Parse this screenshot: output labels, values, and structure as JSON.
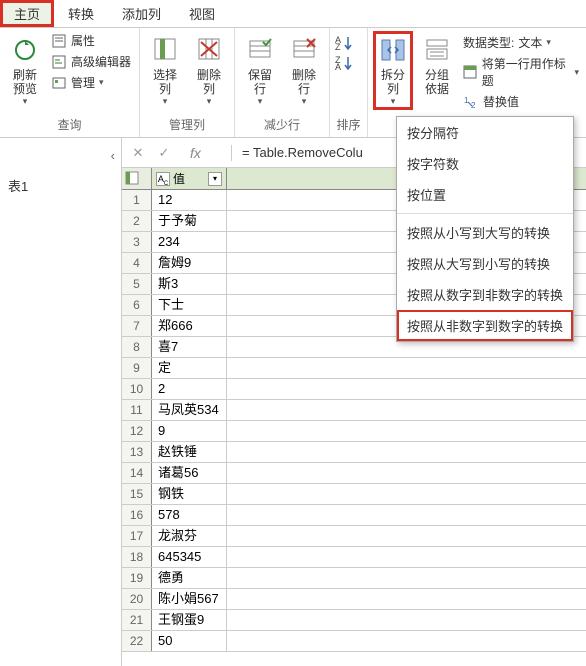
{
  "tabs": [
    "主页",
    "转换",
    "添加列",
    "视图"
  ],
  "ribbon": {
    "query": {
      "refresh": "刷新\n预览",
      "props": "属性",
      "advanced": "高级编辑器",
      "manage": "管理",
      "label": "查询"
    },
    "manage_cols": {
      "select": "选择\n列",
      "remove": "删除\n列",
      "label": "管理列"
    },
    "reduce_rows": {
      "keep": "保留\n行",
      "remove": "删除\n行",
      "label": "减少行"
    },
    "sort": {
      "label": "排序"
    },
    "split": {
      "split": "拆分\n列",
      "group": "分组\n依据",
      "datatype_label": "数据类型:",
      "datatype_value": "文本",
      "first_row": "将第一行用作标题",
      "replace": "替换值"
    }
  },
  "menu": {
    "items": [
      "按分隔符",
      "按字符数",
      "按位置"
    ],
    "items2": [
      "按照从小写到大写的转换",
      "按照从大写到小写的转换",
      "按照从数字到非数字的转换",
      "按照从非数字到数字的转换"
    ]
  },
  "panel": {
    "item": "表1"
  },
  "formula": {
    "text": "= Table.RemoveColu"
  },
  "grid": {
    "column": "值",
    "rows": [
      "12",
      "于予菊",
      "234",
      "詹姆9",
      "斯3",
      "下士",
      "郑666",
      "喜7",
      "定",
      "2",
      "马凤英534",
      "9",
      "赵铁锤",
      "诸葛56",
      "钢铁",
      "578",
      "龙淑芬",
      "645345",
      "德勇",
      "陈小娟567",
      "王钢蛋9",
      "50"
    ]
  }
}
